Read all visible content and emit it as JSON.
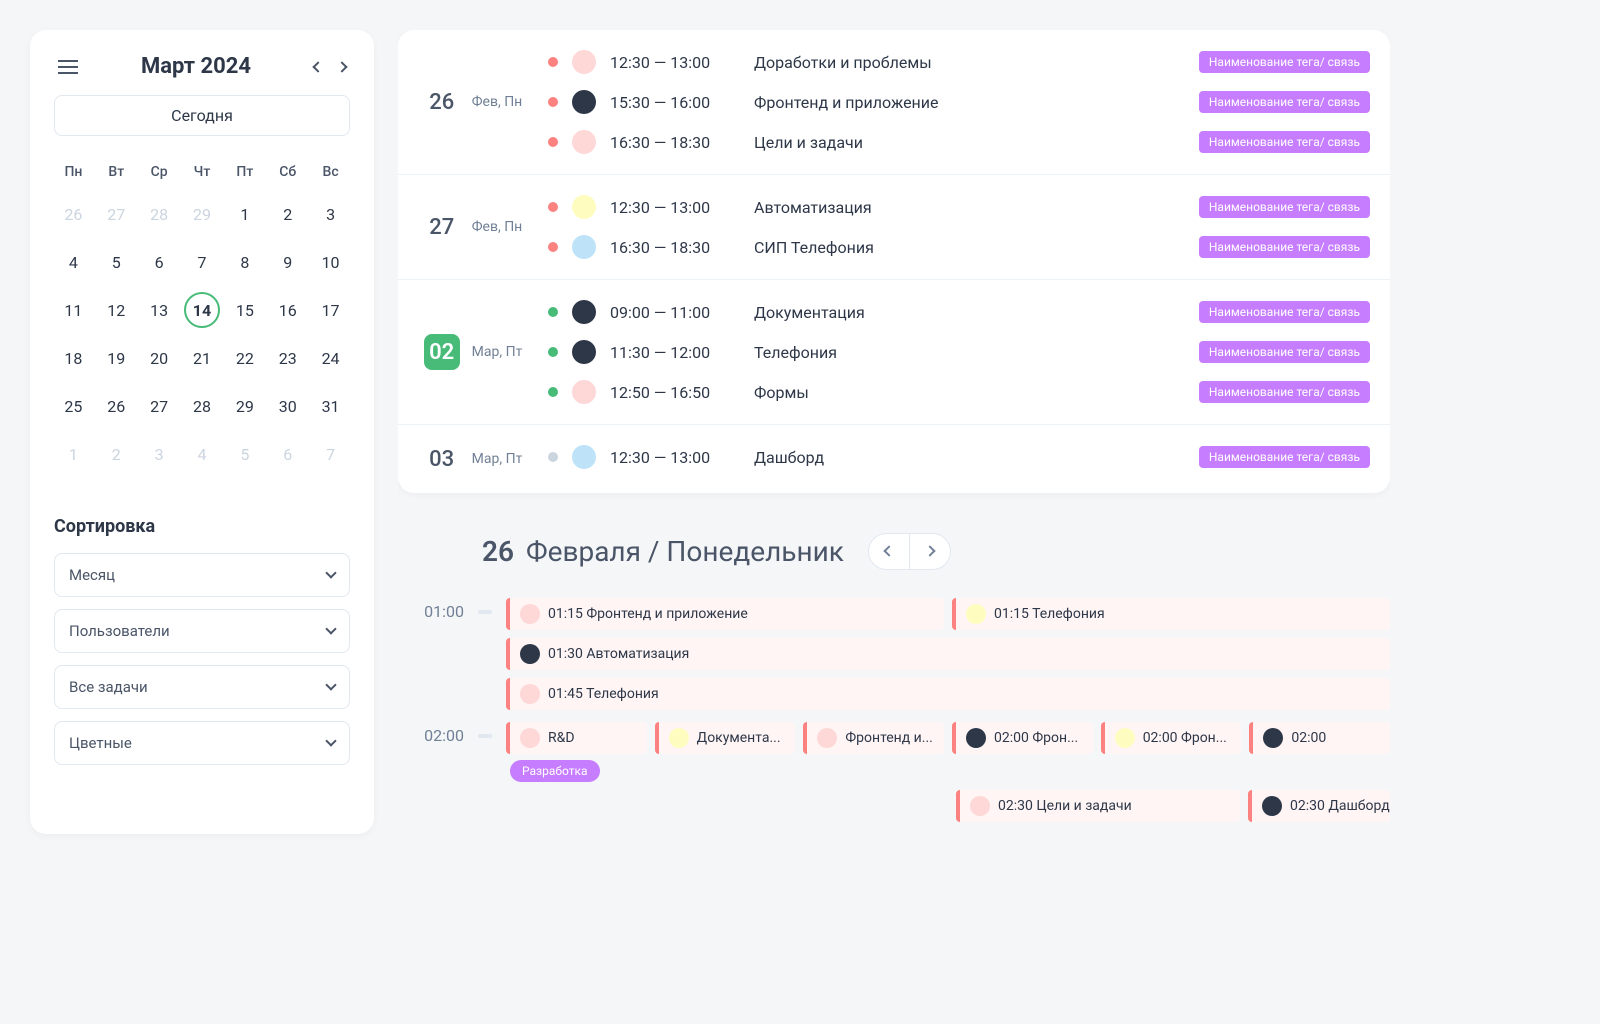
{
  "calendar": {
    "title": "Март 2024",
    "today_btn": "Сегодня",
    "dow": [
      "Пн",
      "Вт",
      "Ср",
      "Чт",
      "Пт",
      "Сб",
      "Вс"
    ],
    "days": [
      {
        "n": "26",
        "other": true
      },
      {
        "n": "27",
        "other": true
      },
      {
        "n": "28",
        "other": true
      },
      {
        "n": "29",
        "other": true
      },
      {
        "n": "1"
      },
      {
        "n": "2"
      },
      {
        "n": "3"
      },
      {
        "n": "4"
      },
      {
        "n": "5"
      },
      {
        "n": "6"
      },
      {
        "n": "7"
      },
      {
        "n": "8"
      },
      {
        "n": "9"
      },
      {
        "n": "10"
      },
      {
        "n": "11"
      },
      {
        "n": "12"
      },
      {
        "n": "13"
      },
      {
        "n": "14",
        "today": true
      },
      {
        "n": "15"
      },
      {
        "n": "16"
      },
      {
        "n": "17"
      },
      {
        "n": "18"
      },
      {
        "n": "19"
      },
      {
        "n": "20"
      },
      {
        "n": "21"
      },
      {
        "n": "22"
      },
      {
        "n": "23"
      },
      {
        "n": "24"
      },
      {
        "n": "25"
      },
      {
        "n": "26"
      },
      {
        "n": "27"
      },
      {
        "n": "28"
      },
      {
        "n": "29"
      },
      {
        "n": "30"
      },
      {
        "n": "31"
      },
      {
        "n": "1",
        "other": true
      },
      {
        "n": "2",
        "other": true
      },
      {
        "n": "3",
        "other": true
      },
      {
        "n": "4",
        "other": true
      },
      {
        "n": "5",
        "other": true
      },
      {
        "n": "6",
        "other": true
      },
      {
        "n": "7",
        "other": true
      }
    ]
  },
  "sort": {
    "title": "Сортировка",
    "selects": [
      "Месяц",
      "Пользователи",
      "Все задачи",
      "Цветные"
    ]
  },
  "agenda": [
    {
      "day": "26",
      "label": "Фев, Пн",
      "active": false,
      "events": [
        {
          "color": "red",
          "avatar": "a1",
          "time": "12:30 — 13:00",
          "title": "Доработки и проблемы",
          "tag": "Наименование тега/ связь"
        },
        {
          "color": "red",
          "avatar": "a2",
          "time": "15:30 — 16:00",
          "title": "Фронтенд и приложение",
          "tag": "Наименование тега/ связь"
        },
        {
          "color": "red",
          "avatar": "a1",
          "time": "16:30 — 18:30",
          "title": "Цели и задачи",
          "tag": "Наименование тега/ связь"
        }
      ]
    },
    {
      "day": "27",
      "label": "Фев, Пн",
      "active": false,
      "events": [
        {
          "color": "red",
          "avatar": "a3",
          "time": "12:30 — 13:00",
          "title": "Автоматизация",
          "tag": "Наименование тега/ связь"
        },
        {
          "color": "red",
          "avatar": "a4",
          "time": "16:30 — 18:30",
          "title": "СИП Телефония",
          "tag": "Наименование тега/ связь"
        }
      ]
    },
    {
      "day": "02",
      "label": "Мар, Пт",
      "active": true,
      "events": [
        {
          "color": "green",
          "avatar": "a2",
          "time": "09:00 — 11:00",
          "title": "Документация",
          "tag": "Наименование тега/ связь"
        },
        {
          "color": "green",
          "avatar": "a2",
          "time": "11:30 — 12:00",
          "title": "Телефония",
          "tag": "Наименование тега/ связь"
        },
        {
          "color": "green",
          "avatar": "a1",
          "time": "12:50 — 16:50",
          "title": "Формы",
          "tag": "Наименование тега/ связь"
        }
      ]
    },
    {
      "day": "03",
      "label": "Мар, Пт",
      "active": false,
      "events": [
        {
          "color": "gray",
          "avatar": "a4",
          "time": "12:30 — 13:00",
          "title": "Дашборд",
          "tag": "Наименование тега/ связь"
        }
      ]
    }
  ],
  "detail": {
    "day_num": "26",
    "day_text": "Февраля / Понедельник",
    "hours": [
      {
        "label": "01:00",
        "rows": [
          [
            {
              "avatar": "a1",
              "text": "01:15 Фронтенд и приложение",
              "wide": true
            },
            {
              "avatar": "a3",
              "text": "01:15 Телефония",
              "wide": true
            }
          ],
          [
            {
              "avatar": "a2",
              "text": "01:30 Автоматизация",
              "wide": true
            }
          ],
          [
            {
              "avatar": "a1",
              "text": "01:45 Телефония",
              "wide": true
            }
          ]
        ]
      },
      {
        "label": "02:00",
        "rows": [
          [
            {
              "avatar": "a1",
              "text": "R&D",
              "subtag": "Разработка"
            },
            {
              "avatar": "a3",
              "text": "Документа..."
            },
            {
              "avatar": "a1",
              "text": "Фронтенд и..."
            },
            {
              "avatar": "a2",
              "text": "02:00 Фрон..."
            },
            {
              "avatar": "a3",
              "text": "02:00 Фрон..."
            },
            {
              "avatar": "a2",
              "text": "02:00"
            }
          ],
          [
            {
              "spacer": true
            },
            {
              "spacer": true
            },
            {
              "spacer": true
            },
            {
              "avatar": "a1",
              "text": "02:30 Цели и задачи",
              "w2": true
            },
            {
              "avatar": "a2",
              "text": "02:30 Дашборд"
            }
          ]
        ]
      }
    ]
  }
}
